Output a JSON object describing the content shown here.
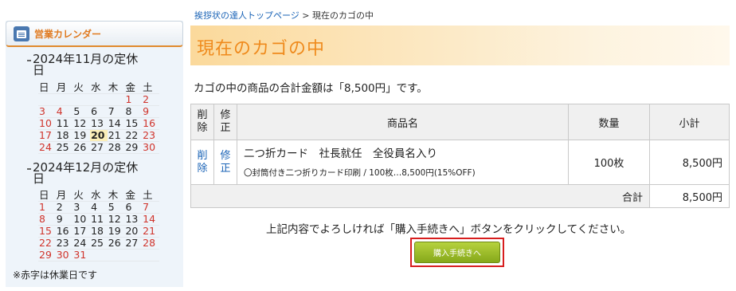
{
  "sidebar": {
    "header_title": "営業カレンダー",
    "calendar_icon": "calendar-icon",
    "note": "※赤字は休業日です",
    "months": [
      {
        "title_line1": "2024年11月の定休",
        "title_line2": "日",
        "weekdays": [
          "日",
          "月",
          "火",
          "水",
          "木",
          "金",
          "土"
        ],
        "weeks": [
          [
            {
              "d": ""
            },
            {
              "d": ""
            },
            {
              "d": ""
            },
            {
              "d": ""
            },
            {
              "d": ""
            },
            {
              "d": "1",
              "hol": true
            },
            {
              "d": "2",
              "hol": true
            }
          ],
          [
            {
              "d": "3",
              "hol": true
            },
            {
              "d": "4",
              "hol": true
            },
            {
              "d": "5"
            },
            {
              "d": "6"
            },
            {
              "d": "7"
            },
            {
              "d": "8"
            },
            {
              "d": "9",
              "hol": true
            }
          ],
          [
            {
              "d": "10",
              "hol": true
            },
            {
              "d": "11"
            },
            {
              "d": "12"
            },
            {
              "d": "13"
            },
            {
              "d": "14"
            },
            {
              "d": "15"
            },
            {
              "d": "16",
              "hol": true
            }
          ],
          [
            {
              "d": "17",
              "hol": true
            },
            {
              "d": "18"
            },
            {
              "d": "19"
            },
            {
              "d": "20",
              "today": true
            },
            {
              "d": "21"
            },
            {
              "d": "22"
            },
            {
              "d": "23",
              "hol": true
            }
          ],
          [
            {
              "d": "24",
              "hol": true
            },
            {
              "d": "25"
            },
            {
              "d": "26"
            },
            {
              "d": "27"
            },
            {
              "d": "28"
            },
            {
              "d": "29"
            },
            {
              "d": "30",
              "hol": true
            }
          ]
        ]
      },
      {
        "title_line1": "2024年12月の定休",
        "title_line2": "日",
        "weekdays": [
          "日",
          "月",
          "火",
          "水",
          "木",
          "金",
          "土"
        ],
        "weeks": [
          [
            {
              "d": "1",
              "hol": true
            },
            {
              "d": "2"
            },
            {
              "d": "3"
            },
            {
              "d": "4"
            },
            {
              "d": "5"
            },
            {
              "d": "6"
            },
            {
              "d": "7",
              "hol": true
            }
          ],
          [
            {
              "d": "8",
              "hol": true
            },
            {
              "d": "9"
            },
            {
              "d": "10"
            },
            {
              "d": "11"
            },
            {
              "d": "12"
            },
            {
              "d": "13"
            },
            {
              "d": "14",
              "hol": true
            }
          ],
          [
            {
              "d": "15",
              "hol": true
            },
            {
              "d": "16"
            },
            {
              "d": "17"
            },
            {
              "d": "18"
            },
            {
              "d": "19"
            },
            {
              "d": "20"
            },
            {
              "d": "21",
              "hol": true
            }
          ],
          [
            {
              "d": "22",
              "hol": true
            },
            {
              "d": "23"
            },
            {
              "d": "24"
            },
            {
              "d": "25"
            },
            {
              "d": "26"
            },
            {
              "d": "27"
            },
            {
              "d": "28",
              "hol": true
            }
          ],
          [
            {
              "d": "29",
              "hol": true
            },
            {
              "d": "30",
              "hol": true
            },
            {
              "d": "31",
              "hol": true
            },
            {
              "d": ""
            },
            {
              "d": ""
            },
            {
              "d": ""
            },
            {
              "d": ""
            }
          ]
        ]
      }
    ],
    "colors": {
      "holiday": "#d0342c",
      "today_bg": "#fbeeb8",
      "header_accent": "#e07a20"
    }
  },
  "breadcrumb": {
    "home_link": "挨拶状の達人トップページ",
    "separator": " > ",
    "current": "現在のカゴの中"
  },
  "page_title": "現在のカゴの中",
  "total_message": "カゴの中の商品の合計金額は「8,500円」です。",
  "cart": {
    "headers": {
      "delete_1": "削",
      "delete_2": "除",
      "modify_1": "修",
      "modify_2": "正",
      "product": "商品名",
      "quantity": "数量",
      "subtotal": "小計"
    },
    "items": [
      {
        "delete_1": "削",
        "delete_2": "除",
        "modify_1": "修",
        "modify_2": "正",
        "name": "二つ折カード　社長就任　全役員名入り",
        "option": "〇封筒付き二つ折りカード印刷 / 100枚…8,500円(15%OFF)",
        "quantity": "100枚",
        "subtotal": "8,500円"
      }
    ],
    "total_label": "合計",
    "total_value": "8,500円"
  },
  "instruction": "上記内容でよろしければ「購入手続きへ」ボタンをクリックしてください。",
  "checkout_button": "購入手続きへ",
  "accent_colors": {
    "title_orange": "#ef8a1c",
    "link_blue": "#1a63b6",
    "button_green": "#9cbd2a",
    "highlight_red": "#d71e1e"
  }
}
